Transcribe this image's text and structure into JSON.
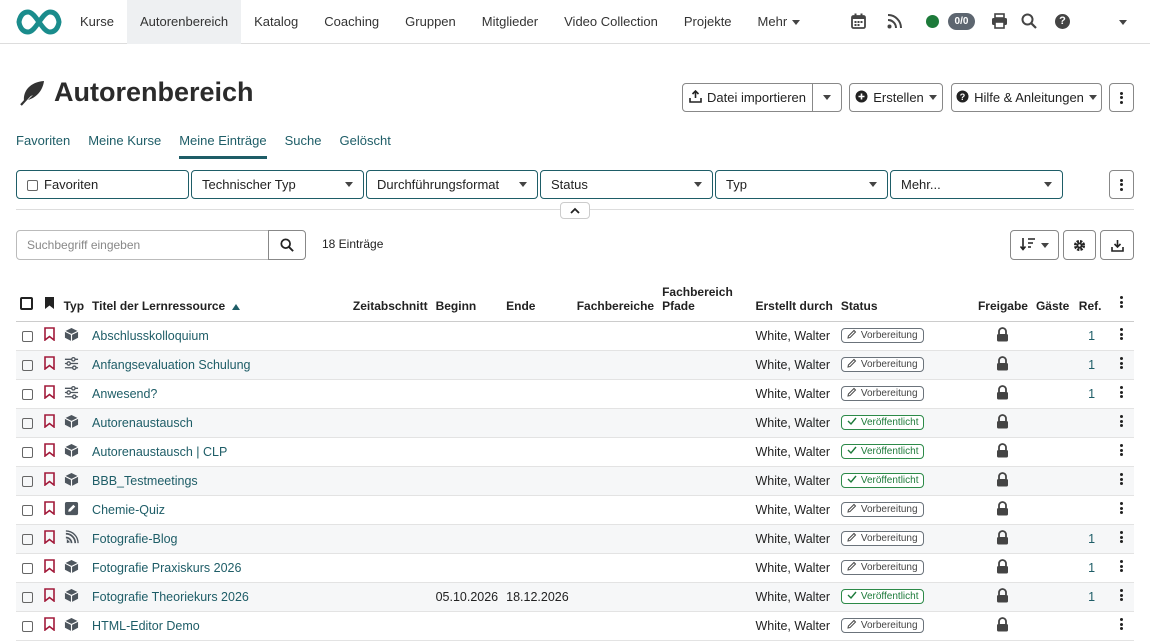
{
  "nav": {
    "items": [
      {
        "label": "Kurse",
        "active": false
      },
      {
        "label": "Autorenbereich",
        "active": true
      },
      {
        "label": "Katalog",
        "active": false
      },
      {
        "label": "Coaching",
        "active": false
      },
      {
        "label": "Gruppen",
        "active": false
      },
      {
        "label": "Mitglieder",
        "active": false
      },
      {
        "label": "Video Collection",
        "active": false
      },
      {
        "label": "Projekte",
        "active": false
      }
    ],
    "more_label": "Mehr",
    "counter": "0/0",
    "help_glyph": "?",
    "icons": [
      "calendar-icon",
      "rss-icon",
      "online-status-icon",
      "print-icon",
      "search-icon",
      "help-icon",
      "user-menu-icon"
    ],
    "brand_color": "#1a8c8c",
    "accent_color": "#1e5d67"
  },
  "header": {
    "title": "Autorenbereich",
    "icon": "feather-icon",
    "import_label": "Datei importieren",
    "create_label": "Erstellen",
    "help_label": "Hilfe & Anleitungen"
  },
  "tabs": [
    {
      "label": "Favoriten",
      "active": false
    },
    {
      "label": "Meine Kurse",
      "active": false
    },
    {
      "label": "Meine Einträge",
      "active": true
    },
    {
      "label": "Suche",
      "active": false
    },
    {
      "label": "Gelöscht",
      "active": false
    }
  ],
  "filters": {
    "favorites": "Favoriten",
    "technical_type": "Technischer Typ",
    "execution_format": "Durchführungsformat",
    "status": "Status",
    "type": "Typ",
    "more": "Mehr..."
  },
  "search": {
    "placeholder": "Suchbegriff eingeben",
    "count_label": "18 Einträge"
  },
  "table": {
    "columns": {
      "type": "Typ",
      "title": "Titel der Lernressource",
      "period": "Zeitabschnitt",
      "begin": "Beginn",
      "end": "Ende",
      "subjects": "Fachbereiche",
      "subject_paths_1": "Fachbereich",
      "subject_paths_2": "Pfade",
      "created_by": "Erstellt durch",
      "status": "Status",
      "release": "Freigabe",
      "guests": "Gäste",
      "ref": "Ref."
    },
    "rows": [
      {
        "type_icon": "course-icon",
        "title": "Abschlusskolloquium",
        "begin": "",
        "end": "",
        "created_by": "White, Walter",
        "status": "Vorbereitung",
        "status_kind": "prep",
        "ref": "1"
      },
      {
        "type_icon": "survey-icon",
        "title": "Anfangsevaluation Schulung",
        "begin": "",
        "end": "",
        "created_by": "White, Walter",
        "status": "Vorbereitung",
        "status_kind": "prep",
        "ref": "1"
      },
      {
        "type_icon": "survey-icon",
        "title": "Anwesend?",
        "begin": "",
        "end": "",
        "created_by": "White, Walter",
        "status": "Vorbereitung",
        "status_kind": "prep",
        "ref": "1"
      },
      {
        "type_icon": "course-icon",
        "title": "Autorenaustausch",
        "begin": "",
        "end": "",
        "created_by": "White, Walter",
        "status": "Veröffentlicht",
        "status_kind": "pub",
        "ref": ""
      },
      {
        "type_icon": "course-icon",
        "title": "Autorenaustausch | CLP",
        "begin": "",
        "end": "",
        "created_by": "White, Walter",
        "status": "Veröffentlicht",
        "status_kind": "pub",
        "ref": ""
      },
      {
        "type_icon": "course-icon",
        "title": "BBB_Testmeetings",
        "begin": "",
        "end": "",
        "created_by": "White, Walter",
        "status": "Veröffentlicht",
        "status_kind": "pub",
        "ref": ""
      },
      {
        "type_icon": "test-icon",
        "title": "Chemie-Quiz",
        "begin": "",
        "end": "",
        "created_by": "White, Walter",
        "status": "Vorbereitung",
        "status_kind": "prep",
        "ref": ""
      },
      {
        "type_icon": "blog-icon",
        "title": "Fotografie-Blog",
        "begin": "",
        "end": "",
        "created_by": "White, Walter",
        "status": "Vorbereitung",
        "status_kind": "prep",
        "ref": "1"
      },
      {
        "type_icon": "course-icon",
        "title": "Fotografie Praxiskurs 2026",
        "begin": "",
        "end": "",
        "created_by": "White, Walter",
        "status": "Vorbereitung",
        "status_kind": "prep",
        "ref": "1"
      },
      {
        "type_icon": "course-icon",
        "title": "Fotografie Theoriekurs 2026",
        "begin": "05.10.2026",
        "end": "18.12.2026",
        "created_by": "White, Walter",
        "status": "Veröffentlicht",
        "status_kind": "pub",
        "ref": "1"
      },
      {
        "type_icon": "course-icon",
        "title": "HTML-Editor Demo",
        "begin": "",
        "end": "",
        "created_by": "White, Walter",
        "status": "Vorbereitung",
        "status_kind": "prep",
        "ref": ""
      }
    ]
  }
}
